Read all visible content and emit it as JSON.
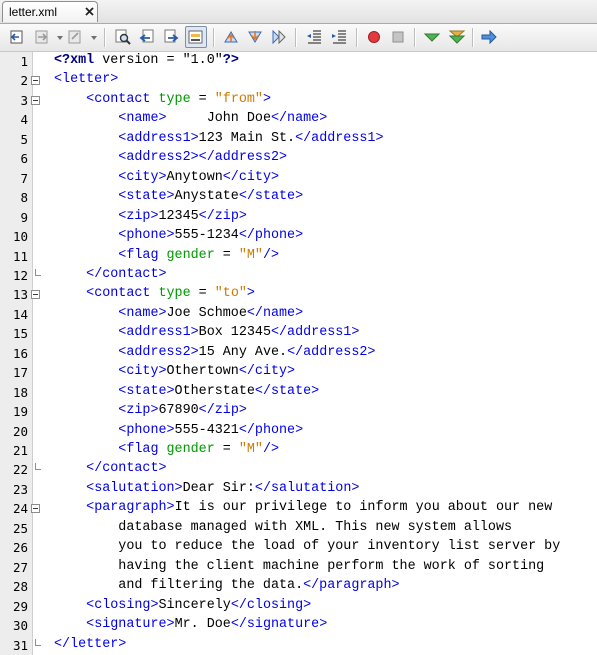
{
  "tab": {
    "title": "letter.xml"
  },
  "toolbar": {
    "buttons": [
      "back-icon",
      "forward-history-icon",
      "last-edit-icon",
      "find-icon",
      "find-previous-icon",
      "find-next-icon",
      "toggle-highlight-icon",
      "previous-bookmark-icon",
      "next-bookmark-icon",
      "toggle-bookmark-icon",
      "shift-left-icon",
      "shift-right-icon",
      "start-macro-icon",
      "stop-macro-icon",
      "check-xml-icon",
      "validate-xml-icon",
      "xsl-transform-icon"
    ]
  },
  "colors": {
    "tag": "#0000e6",
    "attribute": "#009900",
    "value": "#ce7b00",
    "text": "#000000"
  },
  "editor": {
    "lines": [
      {
        "n": "1",
        "fold": "",
        "tokens": [
          [
            "kw",
            "<?xml"
          ],
          [
            "t",
            " version = "
          ],
          [
            "t",
            "\"1.0\""
          ],
          [
            "kw",
            "?>"
          ]
        ]
      },
      {
        "n": "2",
        "fold": "open",
        "tokens": [
          [
            "tag",
            "<letter>"
          ]
        ]
      },
      {
        "n": "3",
        "fold": "open",
        "tokens": [
          [
            "t",
            "    "
          ],
          [
            "tag",
            "<contact "
          ],
          [
            "attr",
            "type"
          ],
          [
            "t",
            " = "
          ],
          [
            "val",
            "\"from\""
          ],
          [
            "tag",
            ">"
          ]
        ]
      },
      {
        "n": "4",
        "fold": "",
        "tokens": [
          [
            "t",
            "        "
          ],
          [
            "tag",
            "<name>"
          ],
          [
            "t",
            "     John Doe"
          ],
          [
            "tag",
            "</name>"
          ]
        ]
      },
      {
        "n": "5",
        "fold": "",
        "tokens": [
          [
            "t",
            "        "
          ],
          [
            "tag",
            "<address1>"
          ],
          [
            "t",
            "123 Main St."
          ],
          [
            "tag",
            "</address1>"
          ]
        ]
      },
      {
        "n": "6",
        "fold": "",
        "tokens": [
          [
            "t",
            "        "
          ],
          [
            "tag",
            "<address2></address2>"
          ]
        ]
      },
      {
        "n": "7",
        "fold": "",
        "tokens": [
          [
            "t",
            "        "
          ],
          [
            "tag",
            "<city>"
          ],
          [
            "t",
            "Anytown"
          ],
          [
            "tag",
            "</city>"
          ]
        ]
      },
      {
        "n": "8",
        "fold": "",
        "tokens": [
          [
            "t",
            "        "
          ],
          [
            "tag",
            "<state>"
          ],
          [
            "t",
            "Anystate"
          ],
          [
            "tag",
            "</state>"
          ]
        ]
      },
      {
        "n": "9",
        "fold": "",
        "tokens": [
          [
            "t",
            "        "
          ],
          [
            "tag",
            "<zip>"
          ],
          [
            "t",
            "12345"
          ],
          [
            "tag",
            "</zip>"
          ]
        ]
      },
      {
        "n": "10",
        "fold": "",
        "tokens": [
          [
            "t",
            "        "
          ],
          [
            "tag",
            "<phone>"
          ],
          [
            "t",
            "555-1234"
          ],
          [
            "tag",
            "</phone>"
          ]
        ]
      },
      {
        "n": "11",
        "fold": "",
        "tokens": [
          [
            "t",
            "        "
          ],
          [
            "tag",
            "<flag "
          ],
          [
            "attr",
            "gender"
          ],
          [
            "t",
            " = "
          ],
          [
            "val",
            "\"M\""
          ],
          [
            "tag",
            "/>"
          ]
        ]
      },
      {
        "n": "12",
        "fold": "end",
        "tokens": [
          [
            "t",
            "    "
          ],
          [
            "tag",
            "</contact>"
          ]
        ]
      },
      {
        "n": "13",
        "fold": "open",
        "tokens": [
          [
            "t",
            "    "
          ],
          [
            "tag",
            "<contact "
          ],
          [
            "attr",
            "type"
          ],
          [
            "t",
            " = "
          ],
          [
            "val",
            "\"to\""
          ],
          [
            "tag",
            ">"
          ]
        ]
      },
      {
        "n": "14",
        "fold": "",
        "tokens": [
          [
            "t",
            "        "
          ],
          [
            "tag",
            "<name>"
          ],
          [
            "t",
            "Joe Schmoe"
          ],
          [
            "tag",
            "</name>"
          ]
        ]
      },
      {
        "n": "15",
        "fold": "",
        "tokens": [
          [
            "t",
            "        "
          ],
          [
            "tag",
            "<address1>"
          ],
          [
            "t",
            "Box 12345"
          ],
          [
            "tag",
            "</address1>"
          ]
        ]
      },
      {
        "n": "16",
        "fold": "",
        "tokens": [
          [
            "t",
            "        "
          ],
          [
            "tag",
            "<address2>"
          ],
          [
            "t",
            "15 Any Ave."
          ],
          [
            "tag",
            "</address2>"
          ]
        ]
      },
      {
        "n": "17",
        "fold": "",
        "tokens": [
          [
            "t",
            "        "
          ],
          [
            "tag",
            "<city>"
          ],
          [
            "t",
            "Othertown"
          ],
          [
            "tag",
            "</city>"
          ]
        ]
      },
      {
        "n": "18",
        "fold": "",
        "tokens": [
          [
            "t",
            "        "
          ],
          [
            "tag",
            "<state>"
          ],
          [
            "t",
            "Otherstate"
          ],
          [
            "tag",
            "</state>"
          ]
        ]
      },
      {
        "n": "19",
        "fold": "",
        "tokens": [
          [
            "t",
            "        "
          ],
          [
            "tag",
            "<zip>"
          ],
          [
            "t",
            "67890"
          ],
          [
            "tag",
            "</zip>"
          ]
        ]
      },
      {
        "n": "20",
        "fold": "",
        "tokens": [
          [
            "t",
            "        "
          ],
          [
            "tag",
            "<phone>"
          ],
          [
            "t",
            "555-4321"
          ],
          [
            "tag",
            "</phone>"
          ]
        ]
      },
      {
        "n": "21",
        "fold": "",
        "tokens": [
          [
            "t",
            "        "
          ],
          [
            "tag",
            "<flag "
          ],
          [
            "attr",
            "gender"
          ],
          [
            "t",
            " = "
          ],
          [
            "val",
            "\"M\""
          ],
          [
            "tag",
            "/>"
          ]
        ]
      },
      {
        "n": "22",
        "fold": "end",
        "tokens": [
          [
            "t",
            "    "
          ],
          [
            "tag",
            "</contact>"
          ]
        ]
      },
      {
        "n": "23",
        "fold": "",
        "tokens": [
          [
            "t",
            "    "
          ],
          [
            "tag",
            "<salutation>"
          ],
          [
            "t",
            "Dear Sir:"
          ],
          [
            "tag",
            "</salutation>"
          ]
        ]
      },
      {
        "n": "24",
        "fold": "open",
        "tokens": [
          [
            "t",
            "    "
          ],
          [
            "tag",
            "<paragraph>"
          ],
          [
            "t",
            "It is our privilege to inform you about our new"
          ]
        ]
      },
      {
        "n": "25",
        "fold": "",
        "tokens": [
          [
            "t",
            "        database managed with XML. This new system allows"
          ]
        ]
      },
      {
        "n": "26",
        "fold": "",
        "tokens": [
          [
            "t",
            "        you to reduce the load of your inventory list server by"
          ]
        ]
      },
      {
        "n": "27",
        "fold": "",
        "tokens": [
          [
            "t",
            "        having the client machine perform the work of sorting"
          ]
        ]
      },
      {
        "n": "28",
        "fold": "",
        "tokens": [
          [
            "t",
            "        and filtering the data."
          ],
          [
            "tag",
            "</paragraph>"
          ]
        ]
      },
      {
        "n": "29",
        "fold": "",
        "tokens": [
          [
            "t",
            "    "
          ],
          [
            "tag",
            "<closing>"
          ],
          [
            "t",
            "Sincerely"
          ],
          [
            "tag",
            "</closing>"
          ]
        ]
      },
      {
        "n": "30",
        "fold": "",
        "tokens": [
          [
            "t",
            "    "
          ],
          [
            "tag",
            "<signature>"
          ],
          [
            "t",
            "Mr. Doe"
          ],
          [
            "tag",
            "</signature>"
          ]
        ]
      },
      {
        "n": "31",
        "fold": "end",
        "tokens": [
          [
            "tag",
            "</letter>"
          ]
        ]
      }
    ]
  }
}
